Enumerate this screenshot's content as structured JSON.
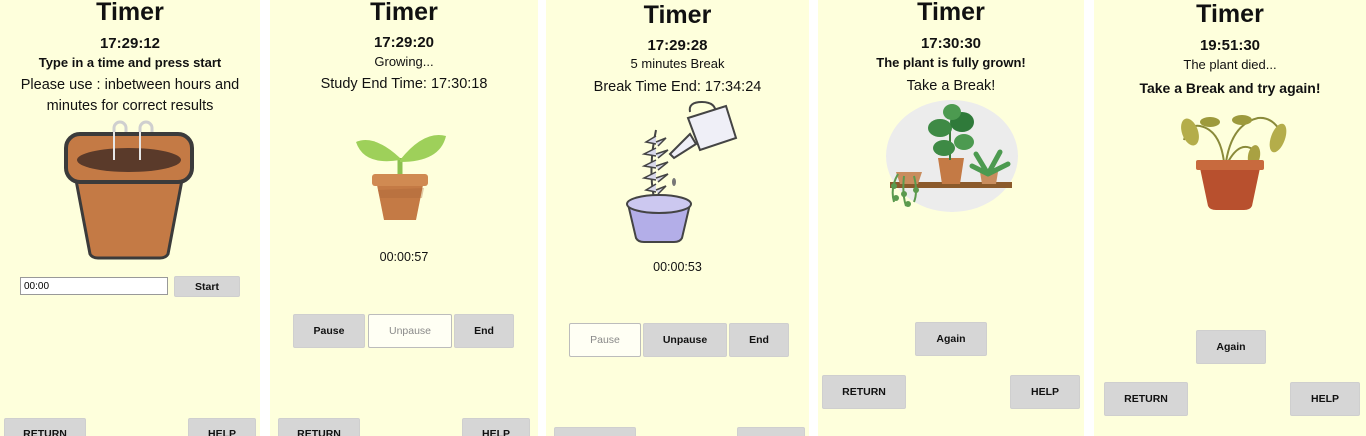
{
  "panels": [
    {
      "title": "Timer",
      "clock": "17:29:12",
      "message": "Type in a time and press start",
      "instructions_line1": "Please use : inbetween hours and",
      "instructions_line2": "minutes for correct results",
      "time_input_value": "00:00",
      "start_label": "Start",
      "return_label": "RETURN",
      "help_label": "HELP",
      "image_icon": "empty-pot-icon"
    },
    {
      "title": "Timer",
      "clock": "17:29:20",
      "message": "Growing...",
      "end_time_text": "Study End Time: 17:30:18",
      "countdown": "00:00:57",
      "pause_label": "Pause",
      "unpause_label": "Unpause",
      "end_label": "End",
      "return_label": "RETURN",
      "help_label": "HELP",
      "image_icon": "sprout-pot-icon"
    },
    {
      "title": "Timer",
      "clock": "17:29:28",
      "message": "5 minutes Break",
      "end_time_text": "Break Time End: 17:34:24",
      "countdown": "00:00:53",
      "pause_label": "Pause",
      "unpause_label": "Unpause",
      "end_label": "End",
      "image_icon": "watering-plant-icon"
    },
    {
      "title": "Timer",
      "clock": "17:30:30",
      "message": "The plant is fully grown!",
      "sub_message": "Take a Break!",
      "again_label": "Again",
      "return_label": "RETURN",
      "help_label": "HELP",
      "image_icon": "grown-plants-shelf-icon"
    },
    {
      "title": "Timer",
      "clock": "19:51:30",
      "message": "The plant died...",
      "sub_message": "Take a Break and try again!",
      "again_label": "Again",
      "return_label": "RETURN",
      "help_label": "HELP",
      "image_icon": "wilted-plant-icon"
    }
  ],
  "colors": {
    "panel_background": "#feffdc",
    "button_background": "#d6d6d6",
    "disabled_button_background": "#fffff4",
    "pot": "#c47a45"
  }
}
